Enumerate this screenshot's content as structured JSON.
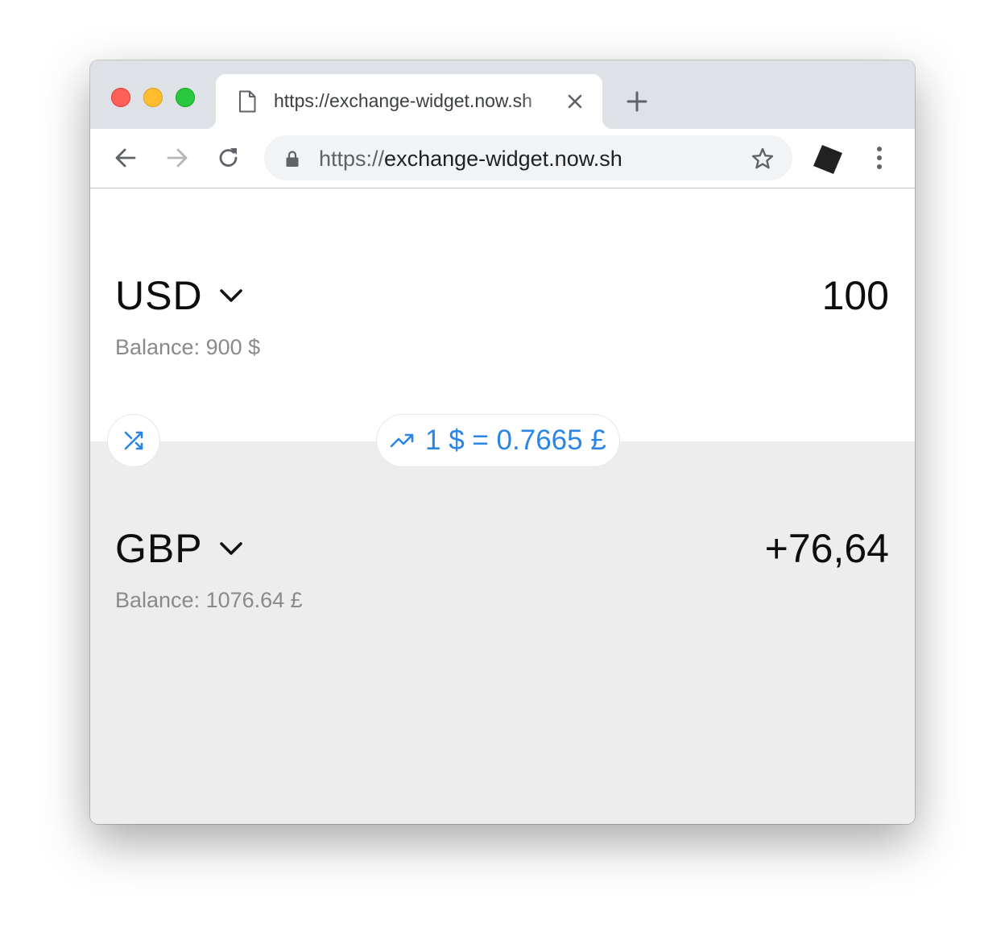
{
  "browser": {
    "tab": {
      "title": "https://exchange-widget.now.sh",
      "icons": {
        "page": "document-icon",
        "close": "close-icon"
      }
    },
    "new_tab_icon": "plus-icon",
    "toolbar": {
      "back_icon": "arrow-left-icon",
      "forward_icon": "arrow-right-icon",
      "reload_icon": "reload-icon",
      "url_scheme": "https://",
      "url_host": "exchange-widget.now.sh",
      "lock_icon": "lock-icon",
      "bookmark_icon": "star-icon",
      "extension_icon": "extension-icon",
      "menu_icon": "kebab-menu-icon"
    }
  },
  "exchange": {
    "from": {
      "currency": "USD",
      "amount": "100",
      "balance": "Balance: 900 $"
    },
    "to": {
      "currency": "GBP",
      "amount": "+76,64",
      "balance": "Balance: 1076.64 £"
    },
    "swap_icon": "shuffle-icon",
    "rate": {
      "icon": "trending-up-icon",
      "text": "1 $ = 0.7665 £"
    }
  },
  "colors": {
    "accent": "#2a85e8",
    "top_panel": "#ffffff",
    "bottom_panel": "#ededed",
    "balance_text": "#8a8a8a"
  }
}
